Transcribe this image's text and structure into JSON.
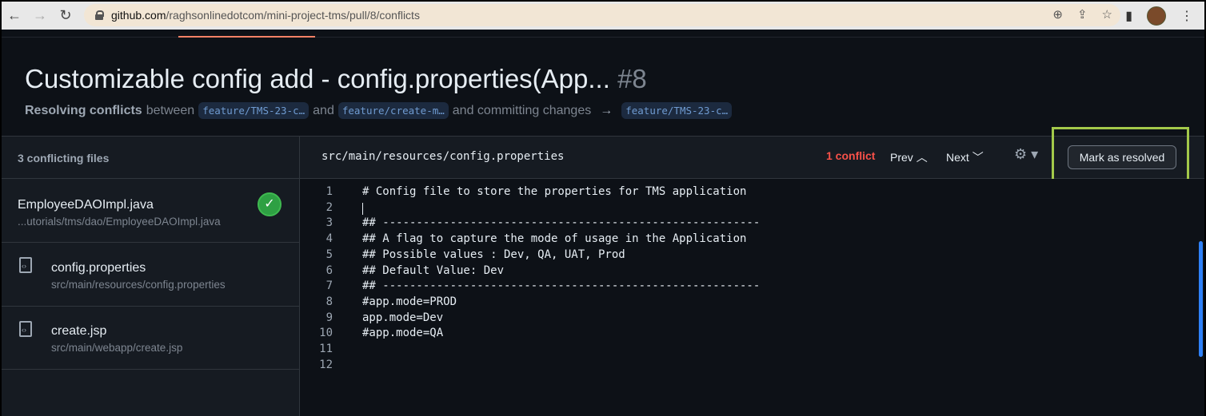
{
  "browser": {
    "url_domain": "github.com",
    "url_path": "/raghsonlinedotcom/mini-project-tms/pull/8/conflicts"
  },
  "pr": {
    "title": "Customizable config add - config.properties(App...",
    "number": "#8",
    "resolving_label": "Resolving conflicts",
    "between_text": "between",
    "head_branch": "feature/TMS-23-c…",
    "and_text": "and",
    "base_branch": "feature/create-m…",
    "committing_text": "and committing changes",
    "arrow": "→",
    "target_branch": "feature/TMS-23-c…"
  },
  "sidebar": {
    "header": "3 conflicting files",
    "files": [
      {
        "name": "EmployeeDAOImpl.java",
        "path": "...utorials/tms/dao/EmployeeDAOImpl.java",
        "resolved": true
      },
      {
        "name": "config.properties",
        "path": "src/main/resources/config.properties",
        "resolved": false
      },
      {
        "name": "create.jsp",
        "path": "src/main/webapp/create.jsp",
        "resolved": false
      }
    ]
  },
  "editor": {
    "path": "src/main/resources/config.properties",
    "conflict_count": "1 conflict",
    "prev_label": "Prev",
    "next_label": "Next",
    "mark_resolved_label": "Mark as resolved",
    "lines": [
      "# Config file to store the properties for TMS application",
      "",
      "## --------------------------------------------------------",
      "## A flag to capture the mode of usage in the Application",
      "## Possible values : Dev, QA, UAT, Prod",
      "## Default Value: Dev",
      "## --------------------------------------------------------",
      "#app.mode=PROD",
      "app.mode=Dev",
      "#app.mode=QA",
      "",
      ""
    ]
  },
  "colors": {
    "accent_underline": "#f78166",
    "conflict_red": "#f85149",
    "check_green": "#2ea043",
    "highlight_box": "#a3c94a"
  }
}
